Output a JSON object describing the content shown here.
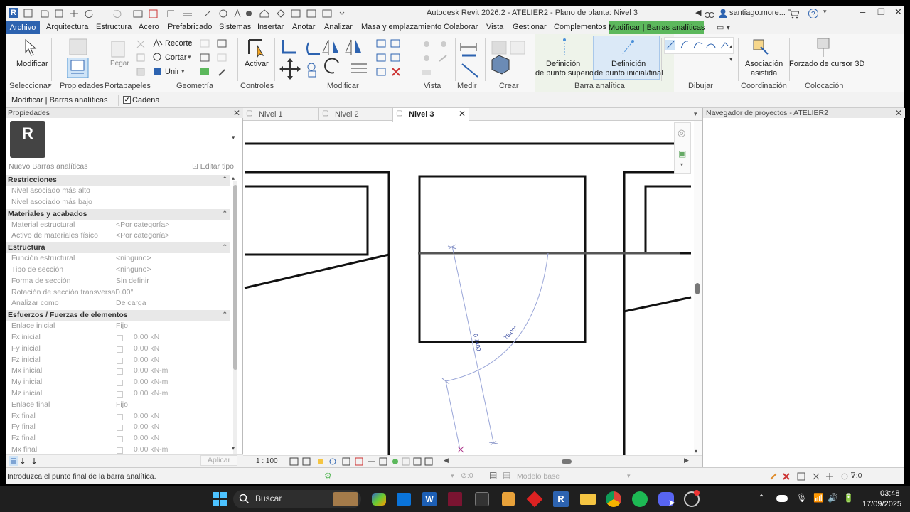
{
  "window": {
    "title": "Autodesk Revit 2026.2 - ATELIER2 - Plano de planta: Nivel 3",
    "user": "santiago.more...",
    "app_icon_letter": "R"
  },
  "menu": {
    "items": [
      "Archivo",
      "Arquitectura",
      "Estructura",
      "Acero",
      "Prefabricado",
      "Sistemas",
      "Insertar",
      "Anotar",
      "Analizar",
      "Masa y emplazamiento",
      "Colaborar",
      "Vista",
      "Gestionar",
      "Complementos",
      "Modificar | Barras analíticas"
    ]
  },
  "ribbon": {
    "modificar": "Modificar",
    "pegar": "Pegar",
    "recorte": "Recorte",
    "cortar": "Cortar",
    "unir": "Unir",
    "activar": "Activar",
    "def_superior_1": "Definición",
    "def_superior_2": "de punto superior",
    "def_inicial_1": "Definición",
    "def_inicial_2": "de punto inicial/final",
    "asociacion_1": "Asociación",
    "asociacion_2": "asistida",
    "forzado": "Forzado de cursor 3D",
    "panels": {
      "seleccionar": "Seleccionar",
      "propiedades": "Propiedades",
      "portapapeles": "Portapapeles",
      "geometria": "Geometría",
      "controles": "Controles",
      "modificar": "Modificar",
      "vista": "Vista",
      "medir": "Medir",
      "crear": "Crear",
      "barra_analitica": "Barra analítica",
      "dibujar": "Dibujar",
      "coordinacion": "Coordinación",
      "colocacion": "Colocación"
    }
  },
  "optionsbar": {
    "context": "Modificar | Barras analíticas",
    "chain_label": "Cadena",
    "chain_checked": true
  },
  "properties": {
    "header": "Propiedades",
    "type_name": "Nuevo Barras analíticas",
    "edit_type": "Editar tipo",
    "apply": "Aplicar",
    "groups": [
      {
        "name": "Restricciones",
        "rows": [
          {
            "key": "Nivel asociado más alto",
            "value": ""
          },
          {
            "key": "Nivel asociado más bajo",
            "value": ""
          }
        ]
      },
      {
        "name": "Materiales y acabados",
        "rows": [
          {
            "key": "Material estructural",
            "value": "<Por categoría>"
          },
          {
            "key": "Activo de materiales físico",
            "value": "<Por categoría>"
          }
        ]
      },
      {
        "name": "Estructura",
        "rows": [
          {
            "key": "Función estructural",
            "value": "<ninguno>"
          },
          {
            "key": "Tipo de sección",
            "value": "<ninguno>"
          },
          {
            "key": "Forma de sección",
            "value": "Sin definir"
          },
          {
            "key": "Rotación de sección transversal",
            "value": "0.00°"
          },
          {
            "key": "Analizar como",
            "value": "De carga"
          }
        ]
      },
      {
        "name": "Esfuerzos / Fuerzas de elementos",
        "rows": [
          {
            "key": "Enlace inicial",
            "value": "Fijo"
          },
          {
            "key": "Fx inicial",
            "value": "0.00 kN",
            "check": true
          },
          {
            "key": "Fy inicial",
            "value": "0.00 kN",
            "check": true
          },
          {
            "key": "Fz inicial",
            "value": "0.00 kN",
            "check": true
          },
          {
            "key": "Mx inicial",
            "value": "0.00 kN-m",
            "check": true
          },
          {
            "key": "My inicial",
            "value": "0.00 kN-m",
            "check": true
          },
          {
            "key": "Mz inicial",
            "value": "0.00 kN-m",
            "check": true
          },
          {
            "key": "Enlace final",
            "value": "Fijo"
          },
          {
            "key": "Fx final",
            "value": "0.00 kN",
            "check": true
          },
          {
            "key": "Fy final",
            "value": "0.00 kN",
            "check": true
          },
          {
            "key": "Fz final",
            "value": "0.00 kN",
            "check": true
          },
          {
            "key": "Mx final",
            "value": "0.00 kN-m",
            "check": true
          }
        ]
      }
    ]
  },
  "views": {
    "tabs": [
      "Nivel 1",
      "Nivel 2",
      "Nivel 3"
    ],
    "active": "Nivel 3",
    "scale": "1 : 100",
    "dim_length": "0.7400",
    "dim_angle": "78.00°"
  },
  "browser": {
    "title": "Navegador de proyectos - ATELIER2"
  },
  "status": {
    "message": "Introduzca el punto final de la barra analítica.",
    "zero": ":0",
    "model": "Modelo base",
    "filter": ":0"
  },
  "taskbar": {
    "search": "Buscar",
    "time": "03:48",
    "date": "17/09/2025"
  },
  "colors": {
    "accent_tab": "#5cb85c",
    "menu_active": "#2d63b0",
    "taskbar": "#1f1f1f"
  }
}
